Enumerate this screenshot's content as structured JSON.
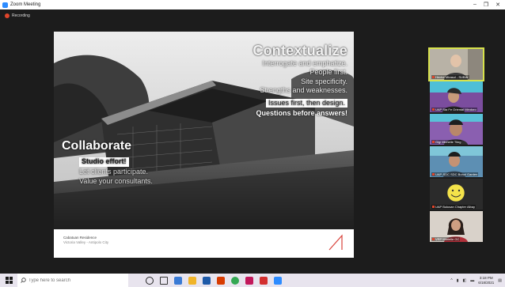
{
  "window": {
    "title": "Zoom Meeting",
    "recording_label": "Recording"
  },
  "slide": {
    "contextualize": {
      "heading": "Contextualize",
      "lines": [
        "Interrogate and emphatize.",
        "People first.",
        "Site specificity.",
        "Strengths and weaknesses."
      ],
      "highlight": "Issues first, then design.",
      "bold": "Questions before answers!"
    },
    "collaborate": {
      "heading": "Collaborate",
      "highlight": "Studio effort!",
      "lines": [
        "Let clients participate.",
        "Value your consultants."
      ]
    },
    "caption": {
      "title": "Cabatuan Residence",
      "sub": "Victoria Valley - Antipolo City"
    }
  },
  "participants": [
    {
      "name": "Hector Mirasol - SUBAr"
    },
    {
      "name": "UAP Sta Fe Oriental Mindoro"
    },
    {
      "name": "Gigi Michelle Tiing"
    },
    {
      "name": "UAP-SDC SDC Bohol Garden"
    },
    {
      "name": "UAP Bulusan Chapter Albay"
    },
    {
      "name": "VRP Marielle GC"
    }
  ],
  "taskbar": {
    "search_placeholder": "Type here to search",
    "time": "3:18 PM",
    "date": "6/18/2021"
  }
}
